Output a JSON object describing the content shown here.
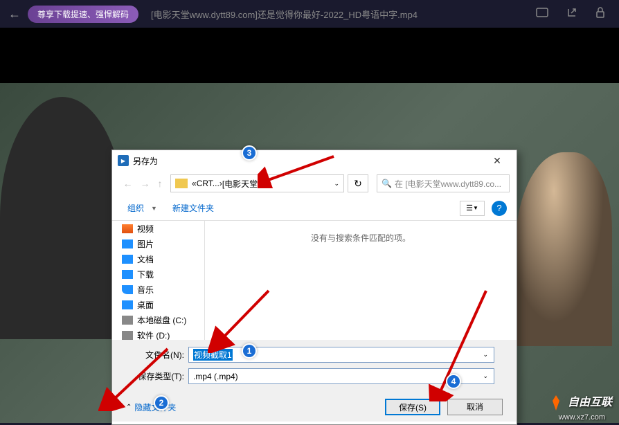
{
  "topbar": {
    "promo_label": "尊享下载提速、强悍解码",
    "file_title": "[电影天堂www.dytt89.com]还是觉得你最好-2022_HD粤语中字.mp4"
  },
  "dialog": {
    "title": "另存为",
    "breadcrumb": {
      "seg1": "CRT...",
      "seg2": "[电影天堂w...",
      "search_placeholder": "在 [电影天堂www.dytt89.co..."
    },
    "toolbar": {
      "organize": "组织",
      "new_folder": "新建文件夹"
    },
    "sidebar": {
      "items": [
        {
          "label": "视频"
        },
        {
          "label": "图片"
        },
        {
          "label": "文档"
        },
        {
          "label": "下载"
        },
        {
          "label": "音乐"
        },
        {
          "label": "桌面"
        },
        {
          "label": "本地磁盘 (C:)"
        },
        {
          "label": "软件 (D:)"
        }
      ]
    },
    "content_empty": "没有与搜索条件匹配的项。",
    "filename_label": "文件名(N):",
    "filename_value": "视频截取1",
    "filetype_label": "保存类型(T):",
    "filetype_value": ".mp4 (.mp4)",
    "hide_folders": "隐藏文件夹",
    "save_btn": "保存(S)",
    "cancel_btn": "取消"
  },
  "annotations": {
    "b1": "1",
    "b2": "2",
    "b3": "3",
    "b4": "4"
  },
  "watermark": {
    "main": "自由互联",
    "sub": "www.xz7.com"
  }
}
